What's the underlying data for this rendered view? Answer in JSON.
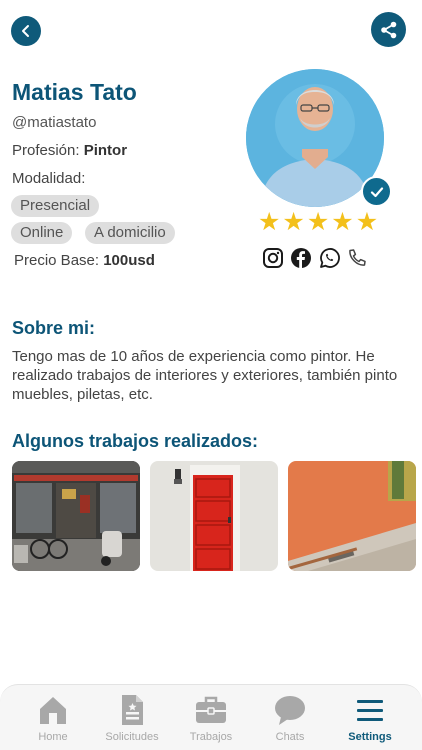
{
  "profile": {
    "name": "Matias Tato",
    "handle": "@matiastato",
    "profession_label": "Profesión:",
    "profession_value": "Pintor",
    "modality_label": "Modalidad:",
    "modalities": [
      "Presencial",
      "Online",
      "A domicilio"
    ],
    "price_label": "Precio Base:",
    "price_value": "100usd",
    "rating": 5,
    "verified": true
  },
  "about": {
    "title": "Sobre mi:",
    "text": "Tengo mas de 10 años de experiencia como pintor. He realizado trabajos de interiores y exteriores, también pinto muebles, piletas, etc."
  },
  "works": {
    "title": "Algunos trabajos realizados:"
  },
  "socials": [
    "instagram-icon",
    "facebook-icon",
    "whatsapp-icon",
    "phone-icon"
  ],
  "nav": [
    {
      "label": "Home",
      "icon": "home-icon",
      "active": false
    },
    {
      "label": "Solicitudes",
      "icon": "document-icon",
      "active": false
    },
    {
      "label": "Trabajos",
      "icon": "briefcase-icon",
      "active": false
    },
    {
      "label": "Chats",
      "icon": "chat-bubble-icon",
      "active": false
    },
    {
      "label": "Settings",
      "icon": "menu-icon",
      "active": true
    }
  ],
  "colors": {
    "primary": "#0f5a7a",
    "heading": "#0d5577",
    "star": "#f3c01b",
    "chip": "#dedede",
    "nav_inactive": "#a8a8a8"
  }
}
